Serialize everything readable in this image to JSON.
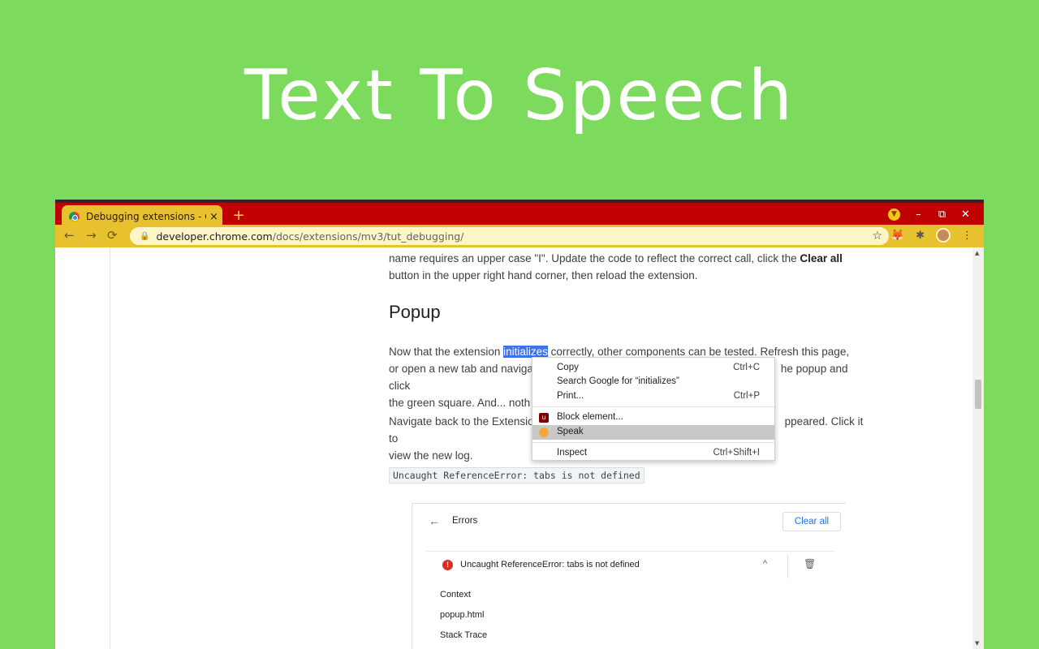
{
  "banner": {
    "title": "Text To Speech"
  },
  "browser": {
    "tab": {
      "title": "Debugging extensions - C",
      "close": "×",
      "favicon": "chrome-icon"
    },
    "newtab": "+",
    "window_controls": {
      "minimize": "–",
      "restore": "⧉",
      "close": "✕"
    },
    "nav": {
      "back": "←",
      "forward": "→",
      "reload": "⟳"
    },
    "address": {
      "host": "developer.chrome.com",
      "path": "/docs/extensions/mv3/tut_debugging/"
    },
    "toolbar_icons": [
      "star-icon",
      "fox-extension-icon",
      "puzzle-icon",
      "avatar-icon",
      "kebab-menu-icon"
    ]
  },
  "article": {
    "para1_line1_pre": "name requires an upper case \"I\". Update the code to reflect the correct call, click the ",
    "para1_bold": "Clear all",
    "para1_line2": "button in the upper right hand corner, then reload the extension.",
    "heading": "Popup",
    "para2_line1_pre": "Now that the extension ",
    "para2_selected": "initializes",
    "para2_line1_post": " correctly, other components can be tested. Refresh this page,",
    "para2_line2_pre": "or open a new tab and naviga",
    "para2_line2_post": "he popup and click",
    "para2_line3": "the green square. And... noth",
    "para3_line1_pre": "Navigate back to the Extensio",
    "para3_line1_post": "ppeared. Click it to",
    "para3_line2": "view the new log.",
    "code": "Uncaught ReferenceError: tabs is not defined"
  },
  "errors_panel": {
    "title": "Errors",
    "clear_all": "Clear all",
    "error_message": "Uncaught ReferenceError: tabs is not defined",
    "context_label": "Context",
    "context_value": "popup.html",
    "stack_label": "Stack Trace"
  },
  "context_menu": {
    "copy": "Copy",
    "copy_shortcut": "Ctrl+C",
    "search": "Search Google for “initializes”",
    "print": "Print...",
    "print_shortcut": "Ctrl+P",
    "block": "Block element...",
    "speak": "Speak",
    "inspect": "Inspect",
    "inspect_shortcut": "Ctrl+Shift+I"
  }
}
